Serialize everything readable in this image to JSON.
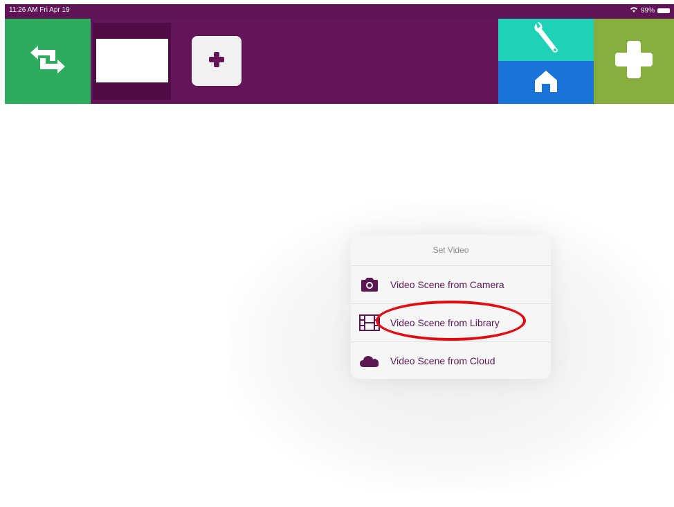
{
  "status_bar": {
    "time": "11:26 AM  Fri Apr 19",
    "battery": "99%"
  },
  "toolbar": {
    "sync_icon": "sync-arrows-icon",
    "add_scene_icon": "plus-icon",
    "tools_icon": "wrench-icon",
    "home_icon": "home-icon",
    "new_icon": "plus-icon"
  },
  "popover": {
    "title": "Set Video",
    "items": [
      {
        "label": "Video Scene from Camera",
        "icon": "camera-icon"
      },
      {
        "label": "Video Scene from Library",
        "icon": "film-icon"
      },
      {
        "label": "Video Scene from Cloud",
        "icon": "cloud-icon"
      }
    ]
  },
  "colors": {
    "toolbar_bg": "#621558",
    "sync_green": "#2eac5d",
    "tools_teal": "#1fd2b7",
    "home_blue": "#1a73d6",
    "new_green": "#86ad3d",
    "highlight_red": "#e30b12",
    "menu_text": "#5a1752"
  }
}
